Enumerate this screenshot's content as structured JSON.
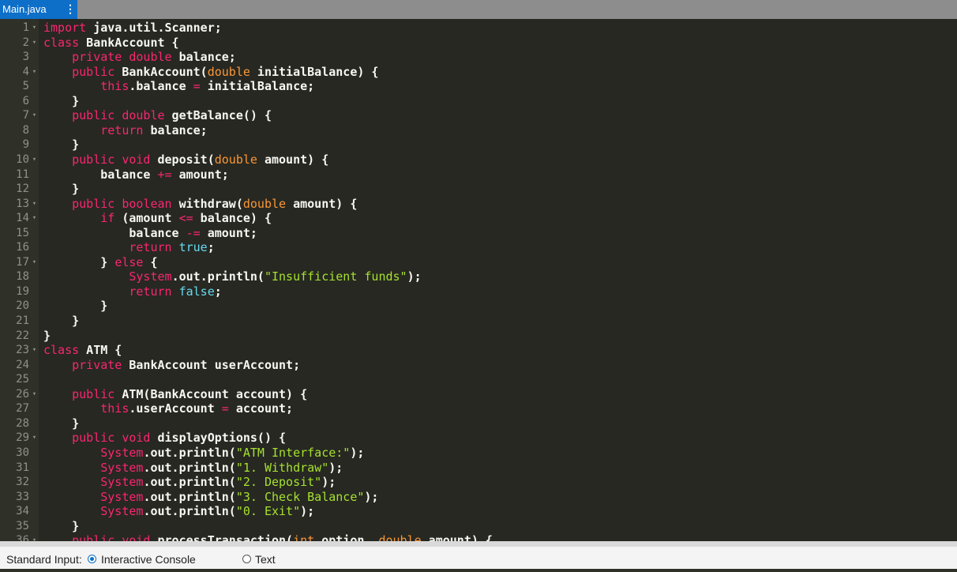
{
  "tab": {
    "filename": "Main.java",
    "menu_icon": "kebab-menu-icon"
  },
  "editor": {
    "lines": [
      {
        "n": "1",
        "fold": true,
        "tokens": [
          [
            "keyword",
            "import"
          ],
          [
            "plain",
            " java.util.Scanner;"
          ]
        ]
      },
      {
        "n": "2",
        "fold": true,
        "tokens": [
          [
            "keyword",
            "class"
          ],
          [
            "plain",
            " BankAccount {"
          ]
        ]
      },
      {
        "n": "3",
        "fold": false,
        "tokens": [
          [
            "plain",
            "    "
          ],
          [
            "keyword",
            "private"
          ],
          [
            "plain",
            " "
          ],
          [
            "keyword",
            "double"
          ],
          [
            "plain",
            " balance;"
          ]
        ]
      },
      {
        "n": "4",
        "fold": true,
        "tokens": [
          [
            "plain",
            "    "
          ],
          [
            "keyword",
            "public"
          ],
          [
            "plain",
            " BankAccount("
          ],
          [
            "storage",
            "double"
          ],
          [
            "plain",
            " initialBalance) {"
          ]
        ]
      },
      {
        "n": "5",
        "fold": false,
        "tokens": [
          [
            "plain",
            "        "
          ],
          [
            "keyword",
            "this"
          ],
          [
            "plain",
            ".balance "
          ],
          [
            "op",
            "="
          ],
          [
            "plain",
            " initialBalance;"
          ]
        ]
      },
      {
        "n": "6",
        "fold": false,
        "tokens": [
          [
            "plain",
            "    }"
          ]
        ]
      },
      {
        "n": "7",
        "fold": true,
        "tokens": [
          [
            "plain",
            "    "
          ],
          [
            "keyword",
            "public"
          ],
          [
            "plain",
            " "
          ],
          [
            "keyword",
            "double"
          ],
          [
            "plain",
            " getBalance() {"
          ]
        ]
      },
      {
        "n": "8",
        "fold": false,
        "tokens": [
          [
            "plain",
            "        "
          ],
          [
            "keyword",
            "return"
          ],
          [
            "plain",
            " balance;"
          ]
        ]
      },
      {
        "n": "9",
        "fold": false,
        "tokens": [
          [
            "plain",
            "    }"
          ]
        ]
      },
      {
        "n": "10",
        "fold": true,
        "tokens": [
          [
            "plain",
            "    "
          ],
          [
            "keyword",
            "public"
          ],
          [
            "plain",
            " "
          ],
          [
            "keyword",
            "void"
          ],
          [
            "plain",
            " deposit("
          ],
          [
            "storage",
            "double"
          ],
          [
            "plain",
            " amount) {"
          ]
        ]
      },
      {
        "n": "11",
        "fold": false,
        "tokens": [
          [
            "plain",
            "        balance "
          ],
          [
            "op",
            "+="
          ],
          [
            "plain",
            " amount;"
          ]
        ]
      },
      {
        "n": "12",
        "fold": false,
        "tokens": [
          [
            "plain",
            "    }"
          ]
        ]
      },
      {
        "n": "13",
        "fold": true,
        "tokens": [
          [
            "plain",
            "    "
          ],
          [
            "keyword",
            "public"
          ],
          [
            "plain",
            " "
          ],
          [
            "keyword",
            "boolean"
          ],
          [
            "plain",
            " withdraw("
          ],
          [
            "storage",
            "double"
          ],
          [
            "plain",
            " amount) {"
          ]
        ]
      },
      {
        "n": "14",
        "fold": true,
        "tokens": [
          [
            "plain",
            "        "
          ],
          [
            "keyword",
            "if"
          ],
          [
            "plain",
            " (amount "
          ],
          [
            "op",
            "<="
          ],
          [
            "plain",
            " balance) {"
          ]
        ]
      },
      {
        "n": "15",
        "fold": false,
        "tokens": [
          [
            "plain",
            "            balance "
          ],
          [
            "op",
            "-="
          ],
          [
            "plain",
            " amount;"
          ]
        ]
      },
      {
        "n": "16",
        "fold": false,
        "tokens": [
          [
            "plain",
            "            "
          ],
          [
            "keyword",
            "return"
          ],
          [
            "plain",
            " "
          ],
          [
            "constant",
            "true"
          ],
          [
            "plain",
            ";"
          ]
        ]
      },
      {
        "n": "17",
        "fold": true,
        "tokens": [
          [
            "plain",
            "        } "
          ],
          [
            "keyword",
            "else"
          ],
          [
            "plain",
            " {"
          ]
        ]
      },
      {
        "n": "18",
        "fold": false,
        "tokens": [
          [
            "plain",
            "            "
          ],
          [
            "support",
            "System"
          ],
          [
            "plain",
            ".out.println("
          ],
          [
            "string",
            "\"Insufficient funds\""
          ],
          [
            "plain",
            ");"
          ]
        ]
      },
      {
        "n": "19",
        "fold": false,
        "tokens": [
          [
            "plain",
            "            "
          ],
          [
            "keyword",
            "return"
          ],
          [
            "plain",
            " "
          ],
          [
            "constant",
            "false"
          ],
          [
            "plain",
            ";"
          ]
        ]
      },
      {
        "n": "20",
        "fold": false,
        "tokens": [
          [
            "plain",
            "        }"
          ]
        ]
      },
      {
        "n": "21",
        "fold": false,
        "tokens": [
          [
            "plain",
            "    }"
          ]
        ]
      },
      {
        "n": "22",
        "fold": false,
        "tokens": [
          [
            "plain",
            "}"
          ]
        ]
      },
      {
        "n": "23",
        "fold": true,
        "tokens": [
          [
            "keyword",
            "class"
          ],
          [
            "plain",
            " ATM {"
          ]
        ]
      },
      {
        "n": "24",
        "fold": false,
        "tokens": [
          [
            "plain",
            "    "
          ],
          [
            "keyword",
            "private"
          ],
          [
            "plain",
            " BankAccount userAccount;"
          ]
        ]
      },
      {
        "n": "25",
        "fold": false,
        "tokens": [
          [
            "plain",
            ""
          ]
        ]
      },
      {
        "n": "26",
        "fold": true,
        "tokens": [
          [
            "plain",
            "    "
          ],
          [
            "keyword",
            "public"
          ],
          [
            "plain",
            " ATM(BankAccount account) {"
          ]
        ]
      },
      {
        "n": "27",
        "fold": false,
        "tokens": [
          [
            "plain",
            "        "
          ],
          [
            "keyword",
            "this"
          ],
          [
            "plain",
            ".userAccount "
          ],
          [
            "op",
            "="
          ],
          [
            "plain",
            " account;"
          ]
        ]
      },
      {
        "n": "28",
        "fold": false,
        "tokens": [
          [
            "plain",
            "    }"
          ]
        ]
      },
      {
        "n": "29",
        "fold": true,
        "tokens": [
          [
            "plain",
            "    "
          ],
          [
            "keyword",
            "public"
          ],
          [
            "plain",
            " "
          ],
          [
            "keyword",
            "void"
          ],
          [
            "plain",
            " displayOptions() {"
          ]
        ]
      },
      {
        "n": "30",
        "fold": false,
        "tokens": [
          [
            "plain",
            "        "
          ],
          [
            "support",
            "System"
          ],
          [
            "plain",
            ".out.println("
          ],
          [
            "string",
            "\"ATM Interface:\""
          ],
          [
            "plain",
            ");"
          ]
        ]
      },
      {
        "n": "31",
        "fold": false,
        "tokens": [
          [
            "plain",
            "        "
          ],
          [
            "support",
            "System"
          ],
          [
            "plain",
            ".out.println("
          ],
          [
            "string",
            "\"1. Withdraw\""
          ],
          [
            "plain",
            ");"
          ]
        ]
      },
      {
        "n": "32",
        "fold": false,
        "tokens": [
          [
            "plain",
            "        "
          ],
          [
            "support",
            "System"
          ],
          [
            "plain",
            ".out.println("
          ],
          [
            "string",
            "\"2. Deposit\""
          ],
          [
            "plain",
            ");"
          ]
        ]
      },
      {
        "n": "33",
        "fold": false,
        "tokens": [
          [
            "plain",
            "        "
          ],
          [
            "support",
            "System"
          ],
          [
            "plain",
            ".out.println("
          ],
          [
            "string",
            "\"3. Check Balance\""
          ],
          [
            "plain",
            ");"
          ]
        ]
      },
      {
        "n": "34",
        "fold": false,
        "tokens": [
          [
            "plain",
            "        "
          ],
          [
            "support",
            "System"
          ],
          [
            "plain",
            ".out.println("
          ],
          [
            "string",
            "\"0. Exit\""
          ],
          [
            "plain",
            ");"
          ]
        ]
      },
      {
        "n": "35",
        "fold": false,
        "tokens": [
          [
            "plain",
            "    }"
          ]
        ]
      },
      {
        "n": "36",
        "fold": true,
        "tokens": [
          [
            "plain",
            "    "
          ],
          [
            "keyword",
            "public"
          ],
          [
            "plain",
            " "
          ],
          [
            "keyword",
            "void"
          ],
          [
            "plain",
            " processTransaction("
          ],
          [
            "storage",
            "int"
          ],
          [
            "plain",
            " option, "
          ],
          [
            "storage",
            "double"
          ],
          [
            "plain",
            " amount) {"
          ]
        ]
      }
    ]
  },
  "stdin": {
    "label": "Standard Input:",
    "options": [
      {
        "label": "Interactive Console",
        "selected": true
      },
      {
        "label": "Text",
        "selected": false
      }
    ]
  },
  "colors": {
    "tab_active": "#0d6fc8",
    "tabbar": "#8d8d8d",
    "editor_bg": "#272822",
    "gutter_bg": "#2f3129",
    "keyword": "#f92672",
    "string": "#a6e22e",
    "constant": "#66d9ef",
    "storage": "#f99737"
  }
}
